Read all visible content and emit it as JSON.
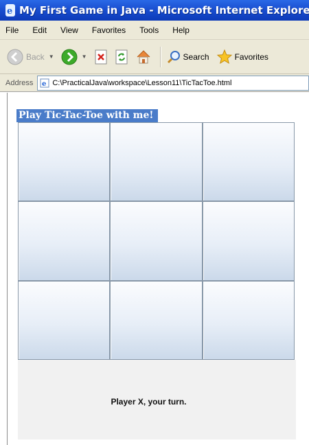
{
  "window": {
    "title": "My First Game in Java - Microsoft Internet Explorer"
  },
  "menu": {
    "items": [
      {
        "label": "File"
      },
      {
        "label": "Edit"
      },
      {
        "label": "View"
      },
      {
        "label": "Favorites"
      },
      {
        "label": "Tools"
      },
      {
        "label": "Help"
      }
    ]
  },
  "toolbar": {
    "back_label": "Back",
    "search_label": "Search",
    "favorites_label": "Favorites"
  },
  "address": {
    "label": "Address",
    "value": "C:\\PracticalJava\\workspace\\Lesson11\\TicTacToe.html"
  },
  "game": {
    "title": "Play Tic-Tac-Toe with me!",
    "status": "Player X, your turn.",
    "cells": [
      "",
      "",
      "",
      "",
      "",
      "",
      "",
      "",
      ""
    ]
  },
  "colors": {
    "titlebar": "#1a4fd1",
    "chrome": "#ece9d8",
    "game_title_bg": "#4a7cc9",
    "cell_top": "#fbfcfe",
    "cell_bottom": "#cbd9ea",
    "grid_line": "#8797a8",
    "status_bg": "#f1f1f1"
  }
}
